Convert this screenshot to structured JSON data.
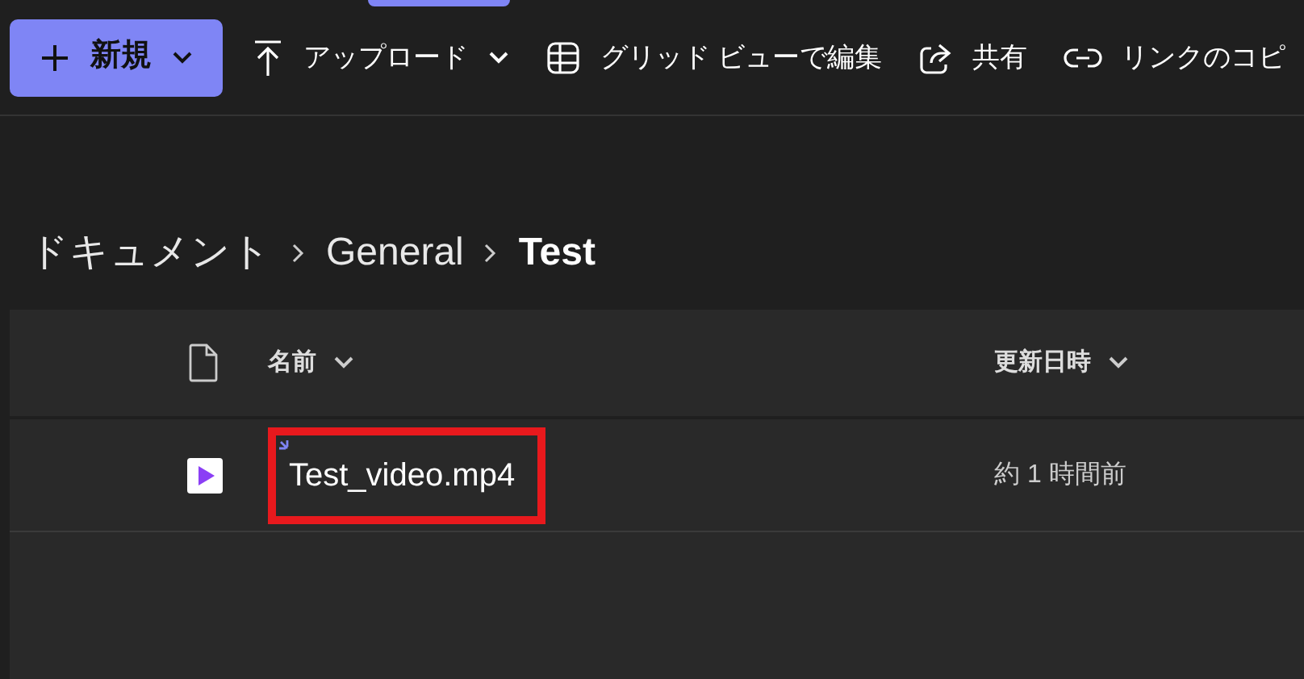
{
  "toolbar": [
    {
      "kind": "new",
      "label": "新規",
      "caret": true
    },
    {
      "kind": "upload",
      "label": "アップロード",
      "caret": true
    },
    {
      "kind": "grid",
      "label": "グリッド ビューで編集",
      "caret": false
    },
    {
      "kind": "share",
      "label": "共有",
      "caret": false
    },
    {
      "kind": "link",
      "label": "リンクのコピ",
      "caret": false
    }
  ],
  "breadcrumb": [
    {
      "label": "ドキュメント",
      "current": false
    },
    {
      "label": "General",
      "current": false
    },
    {
      "label": "Test",
      "current": true
    }
  ],
  "table": {
    "columns": [
      "名前",
      "更新日時"
    ],
    "rows": [
      {
        "name": "Test_video.mp4",
        "modified": "約 1 時間前",
        "new": true,
        "highlighted": true
      }
    ]
  }
}
